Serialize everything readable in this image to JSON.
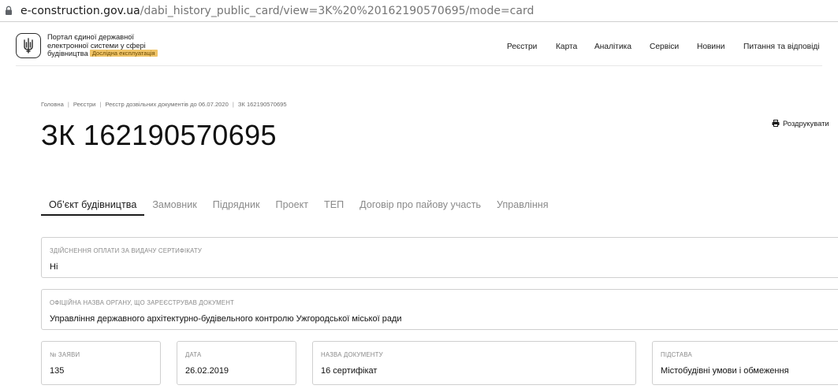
{
  "browser": {
    "url_host": "e-construction.gov.ua",
    "url_path": "/dabi_history_public_card/view=3K%20%20162190570695/mode=card"
  },
  "header": {
    "brand_line1": "Портал єдиної державної",
    "brand_line2": "електронної системи у сфері",
    "brand_line3": "будівництва",
    "badge": "Дослідна експлуатація",
    "nav": [
      "Реєстри",
      "Карта",
      "Аналітика",
      "Сервіси",
      "Новини",
      "Питання та відповіді"
    ]
  },
  "breadcrumb": [
    "Головна",
    "Реєстри",
    "Реєстр дозвільних документів до 06.07.2020",
    "ЗК 162190570695"
  ],
  "page_title": "ЗК 162190570695",
  "print_label": "Роздрукувати",
  "tabs": [
    "Об’єкт будівництва",
    "Замовник",
    "Підрядник",
    "Проект",
    "ТЕП",
    "Договір про пайову участь",
    "Управління"
  ],
  "active_tab": "Об’єкт будівництва",
  "fields": {
    "payment": {
      "label": "Здійснення оплати за видачу сертифікату",
      "value": "Ні"
    },
    "authority": {
      "label": "Офіційна назва органу, що зареєстрував документ",
      "value": "Управління державного архітектурно-будівельного контролю Ужгородської міської ради"
    },
    "app_no": {
      "label": "№ заяви",
      "value": "135"
    },
    "date": {
      "label": "Дата",
      "value": "26.02.2019"
    },
    "doc_name": {
      "label": "Назва документу",
      "value": "16 сертифікат"
    },
    "basis": {
      "label": "Підстава",
      "value": "Містобудівні умови і обмеження"
    }
  }
}
